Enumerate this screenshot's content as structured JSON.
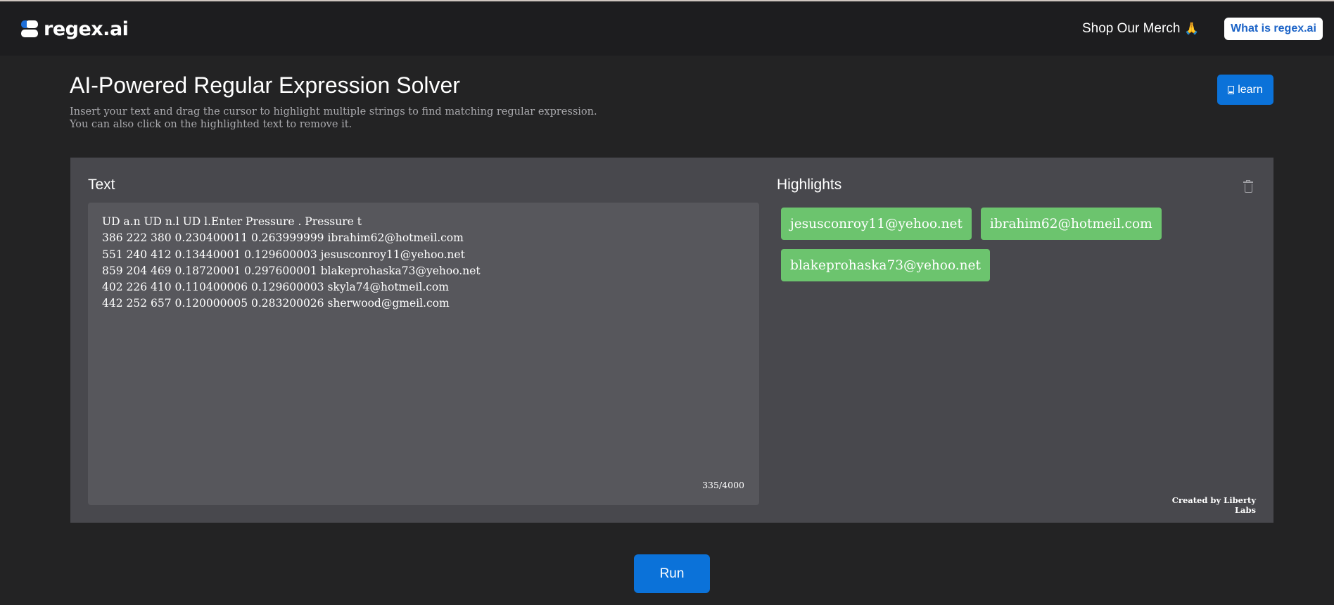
{
  "navbar": {
    "logo_text": "regex.ai",
    "merch_label": "Shop Our Merch",
    "merch_icon": "🙏",
    "what_label": "What is regex.ai"
  },
  "header": {
    "title": "AI-Powered Regular Expression Solver",
    "subtitle_line1": "Insert your text and drag the cursor to highlight multiple strings to find matching regular expression.",
    "subtitle_line2": "You can also click on the highlighted text to remove it.",
    "learn_label": "learn"
  },
  "text_section": {
    "title": "Text",
    "content": "UD a.n UD n.l UD l.Enter Pressure . Pressure t\n386 222 380 0.230400011 0.263999999 ibrahim62@hotmeil.com\n551 240 412 0.13440001 0.129600003 jesusconroy11@yehoo.net\n859 204 469 0.18720001 0.297600001 blakeprohaska73@yehoo.net\n402 226 410 0.110400006 0.129600003 skyla74@hotmeil.com\n442 252 657 0.120000005 0.283200026 sherwood@gmeil.com",
    "char_count": "335/4000"
  },
  "highlights_section": {
    "title": "Highlights",
    "chips": [
      "jesusconroy11@yehoo.net",
      "ibrahim62@hotmeil.com",
      "blakeprohaska73@yehoo.net"
    ],
    "chip_color": "#6cc46e"
  },
  "footer": {
    "credit": "Created by Liberty Labs",
    "run_label": "Run"
  },
  "colors": {
    "accent": "#0b72d9",
    "background": "#232324",
    "panel": "#48484d"
  }
}
